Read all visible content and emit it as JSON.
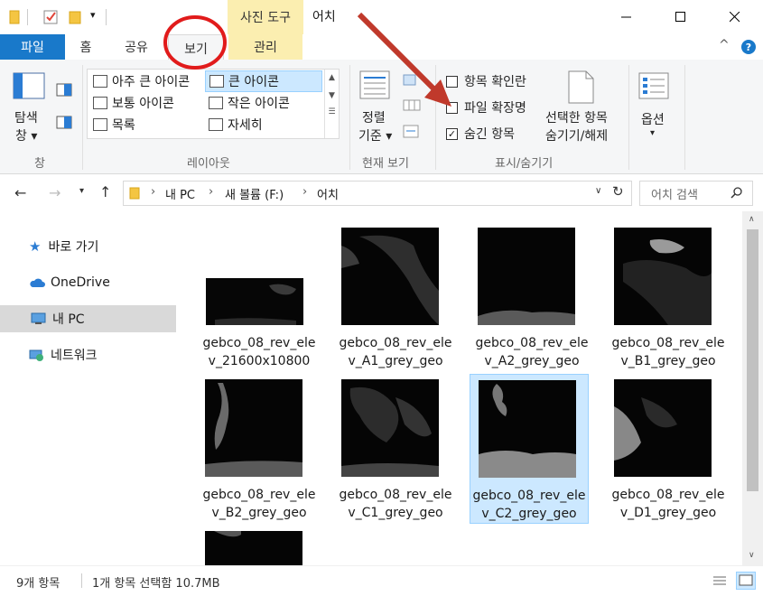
{
  "window": {
    "title": "어치",
    "context_tab": "사진 도구",
    "buttons": [
      "minimize",
      "maximize",
      "close"
    ]
  },
  "ribbon": {
    "tabs": [
      "파일",
      "홈",
      "공유",
      "보기",
      "관리"
    ],
    "panes": {
      "nav_pane_label": [
        "탐색",
        "창 ▾"
      ],
      "group_label": "창"
    },
    "layout": {
      "items": [
        "아주 큰 아이콘",
        "큰 아이콘",
        "보통 아이콘",
        "작은 아이콘",
        "목록",
        "자세히"
      ],
      "selected": "큰 아이콘",
      "group_label": "레이아웃"
    },
    "current_view": {
      "sort_label": [
        "정렬",
        "기준 ▾"
      ],
      "group_label": "현재 보기"
    },
    "show_hide": {
      "checkboxes": [
        {
          "label": "항목 확인란",
          "checked": false
        },
        {
          "label": "파일 확장명",
          "checked": false
        },
        {
          "label": "숨긴 항목",
          "checked": true
        }
      ],
      "hide_selected": [
        "선택한 항목",
        "숨기기/해제"
      ],
      "group_label": "표시/숨기기"
    },
    "options": [
      "옵션",
      "▾"
    ]
  },
  "address": {
    "path": [
      "내 PC",
      "새 볼륨 (F:)",
      "어치"
    ],
    "search_placeholder": "어치 검색"
  },
  "nav_pane": {
    "items": [
      {
        "label": "바로 가기",
        "icon": "star-icon",
        "selected": false
      },
      {
        "label": "OneDrive",
        "icon": "cloud-icon",
        "selected": false
      },
      {
        "label": "내 PC",
        "icon": "computer-icon",
        "selected": true
      },
      {
        "label": "네트워크",
        "icon": "network-icon",
        "selected": false
      }
    ]
  },
  "files": [
    {
      "name": [
        "gebco_08_rev_ele",
        "v_21600x10800"
      ],
      "selected": false
    },
    {
      "name": [
        "gebco_08_rev_ele",
        "v_A1_grey_geo"
      ],
      "selected": false
    },
    {
      "name": [
        "gebco_08_rev_ele",
        "v_A2_grey_geo"
      ],
      "selected": false
    },
    {
      "name": [
        "gebco_08_rev_ele",
        "v_B1_grey_geo"
      ],
      "selected": false
    },
    {
      "name": [
        "gebco_08_rev_ele",
        "v_B2_grey_geo"
      ],
      "selected": false
    },
    {
      "name": [
        "gebco_08_rev_ele",
        "v_C1_grey_geo"
      ],
      "selected": false
    },
    {
      "name": [
        "gebco_08_rev_ele",
        "v_C2_grey_geo"
      ],
      "selected": true
    },
    {
      "name": [
        "gebco_08_rev_ele",
        "v_D1_grey_geo"
      ],
      "selected": false
    }
  ],
  "status": {
    "count": "9개 항목",
    "selection": "1개 항목 선택함 10.7MB"
  },
  "colors": {
    "accent": "#1979ca",
    "context_tab": "#fbeeb0",
    "selection": "#cce8ff",
    "annotation": "#e11b1b",
    "arrow": "#c0392b"
  }
}
